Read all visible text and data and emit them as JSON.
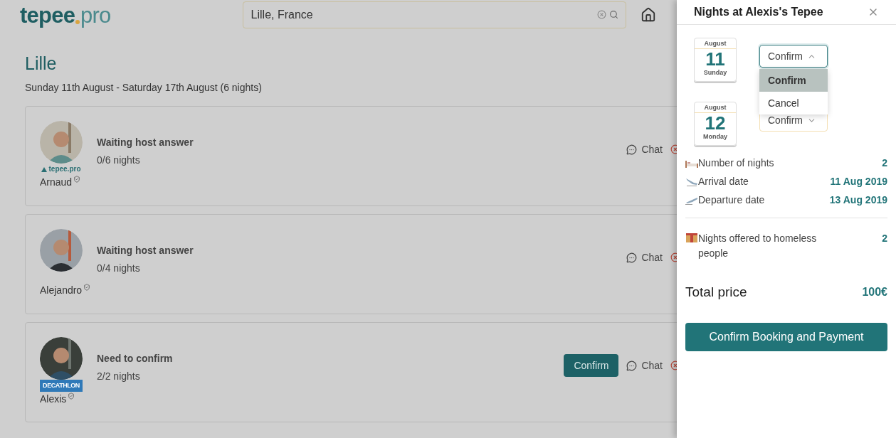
{
  "logo": {
    "name": "tepee",
    "suffix": "pro"
  },
  "search": {
    "value": "Lille, France"
  },
  "city": "Lille",
  "dates": "Sunday 11th August - Saturday 17th August (6 nights)",
  "hosts": [
    {
      "name": "Arnaud",
      "badge": {
        "text": "tepee.pro",
        "kind": "tepee"
      },
      "status": "Waiting host answer",
      "nights": "0/6 nights",
      "chat": "Chat"
    },
    {
      "name": "Alejandro",
      "status": "Waiting host answer",
      "nights": "0/4 nights",
      "chat": "Chat"
    },
    {
      "name": "Alexis",
      "badge": {
        "text": "DECATHLON",
        "kind": "decathlon"
      },
      "status": "Need to confirm",
      "nights": "2/2 nights",
      "action": "Confirm",
      "chat": "Chat"
    }
  ],
  "drawer": {
    "title": "Nights at Alexis's Tepee",
    "nights": [
      {
        "month": "August",
        "day": "11",
        "weekday": "Sunday",
        "status": "Confirm",
        "open": true,
        "options": [
          {
            "label": "Confirm",
            "selected": true
          },
          {
            "label": "Cancel",
            "selected": false
          }
        ]
      },
      {
        "month": "August",
        "day": "12",
        "weekday": "Monday",
        "status": "Confirm",
        "open": false
      }
    ],
    "summary": [
      {
        "kind": "bed",
        "label": "Number of nights",
        "value": "2"
      },
      {
        "kind": "arrival",
        "label": "Arrival date",
        "value": "11 Aug 2019"
      },
      {
        "kind": "departure",
        "label": "Departure date",
        "value": "13 Aug 2019"
      }
    ],
    "offered": {
      "label": "Nights offered to homeless people",
      "value": "2"
    },
    "total": {
      "label": "Total price",
      "value": "100€"
    },
    "button": "Confirm Booking and Payment"
  }
}
